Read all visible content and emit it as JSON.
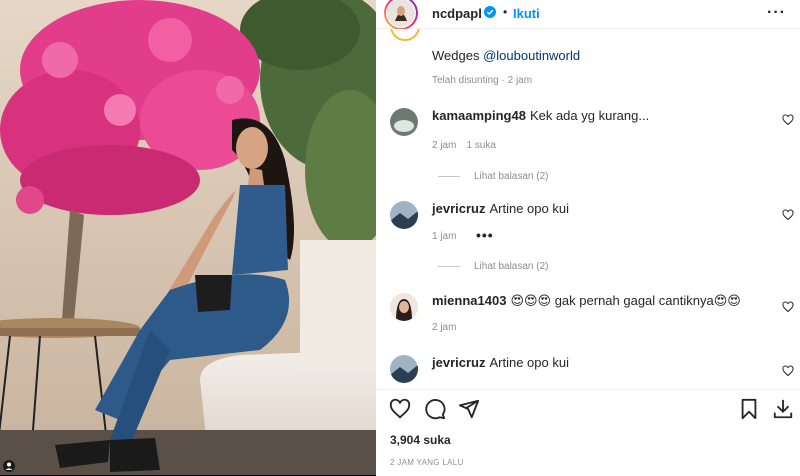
{
  "post": {
    "username": "ncdpapl",
    "follow_label": "Ikuti",
    "dot": "•",
    "more": "···"
  },
  "caption": {
    "text": "Wedges ",
    "mention": "@louboutinworld",
    "meta": "Telah disunting · 2 jam"
  },
  "comments": [
    {
      "username": "kamaamping48",
      "text": "Kek ada yg kurang...",
      "time": "2 jam",
      "likes": "1 suka",
      "replies": "Lihat balasan (2)"
    },
    {
      "username": "jevricruz",
      "text": "Artine opo kui",
      "time": "1 jam",
      "more": "•••",
      "replies": "Lihat balasan (2)"
    },
    {
      "username": "mienna1403",
      "text": "😍😍😍 gak pernah gagal cantiknya😍😍",
      "time": "2 jam"
    },
    {
      "username": "jevricruz",
      "text": "Artine opo kui"
    }
  ],
  "actions": {
    "likes": "3,904 suka",
    "time_ago": "2 JAM YANG LALU"
  },
  "colors": {
    "accent": "#0095f6",
    "text": "#262626",
    "muted": "#8e8e8e",
    "link": "#00376b"
  },
  "icons": [
    "verified-badge-icon",
    "more-options-icon",
    "heart-icon",
    "comment-icon",
    "share-icon",
    "bookmark-icon",
    "download-icon",
    "profile-icon"
  ]
}
